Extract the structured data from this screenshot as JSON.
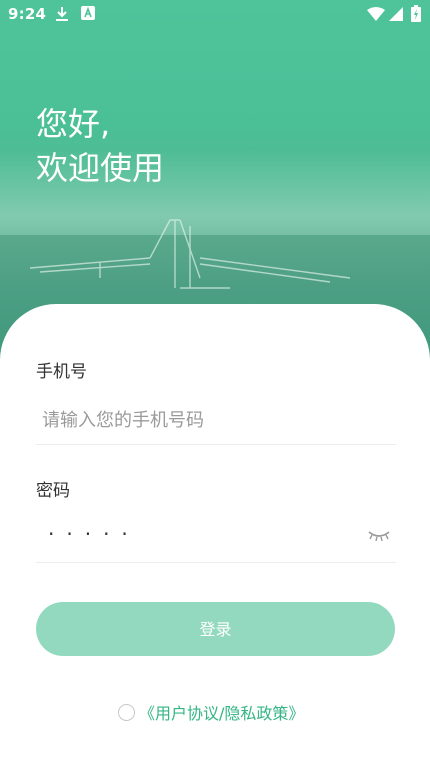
{
  "status_bar": {
    "time": "9:24",
    "left_icons": [
      "download-icon",
      "a-icon"
    ],
    "right_icons": [
      "wifi-icon",
      "signal-icon",
      "battery-charging-icon"
    ]
  },
  "header": {
    "greeting_line1": "您好,",
    "greeting_line2": "欢迎使用"
  },
  "form": {
    "phone": {
      "label": "手机号",
      "placeholder": "请输入您的手机号码"
    },
    "password": {
      "label": "密码",
      "masked_value": "·····",
      "visibility_icon": "eye-closed-icon"
    },
    "login_button": "登录"
  },
  "agreement": {
    "checked": false,
    "text": "《用户协议/隐私政策》"
  },
  "colors": {
    "accent": "#4fc39a",
    "button_bg": "#93d9c0",
    "link": "#34b585"
  }
}
